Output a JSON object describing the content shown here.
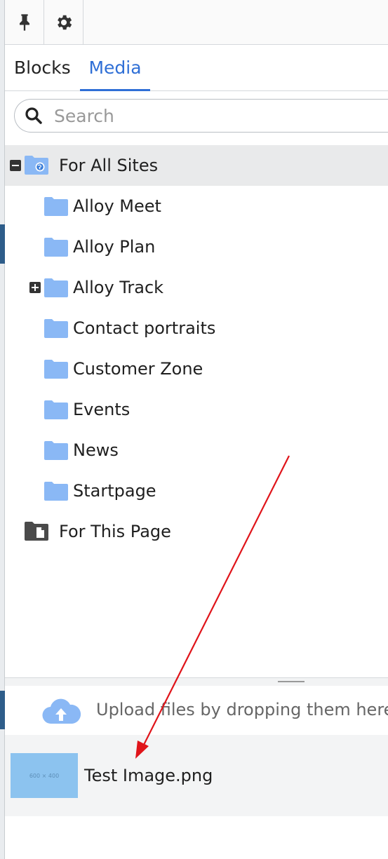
{
  "toolbar": {
    "pin_icon": "pin-icon",
    "settings_icon": "gear-icon"
  },
  "tabs": [
    {
      "label": "Blocks",
      "active": false
    },
    {
      "label": "Media",
      "active": true
    }
  ],
  "search": {
    "placeholder": "Search",
    "value": ""
  },
  "tree": {
    "root_all_sites": {
      "label": "For All Sites",
      "expanded": true,
      "selected": true
    },
    "children": [
      {
        "label": "Alloy Meet",
        "expandable": false
      },
      {
        "label": "Alloy Plan",
        "expandable": false
      },
      {
        "label": "Alloy Track",
        "expandable": true
      },
      {
        "label": "Contact portraits",
        "expandable": false
      },
      {
        "label": "Customer Zone",
        "expandable": false
      },
      {
        "label": "Events",
        "expandable": false
      },
      {
        "label": "News",
        "expandable": false
      },
      {
        "label": "Startpage",
        "expandable": false
      }
    ],
    "root_this_page": {
      "label": "For This Page"
    }
  },
  "upload": {
    "text": "Upload files by dropping them here",
    "icon": "cloud-upload-icon"
  },
  "files": [
    {
      "name": "Test Image.png",
      "thumb_label": "600 × 400"
    }
  ],
  "colors": {
    "accent": "#2f6fd6",
    "folder": "#8ab8f5",
    "selected_row": "#e9eaeb",
    "arrow": "#e0141a",
    "thumb": "#8cc3ef"
  }
}
